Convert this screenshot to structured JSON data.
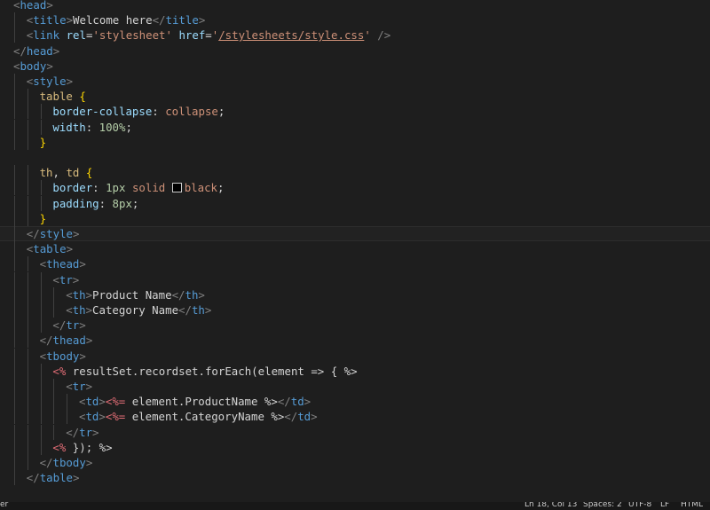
{
  "editor": {
    "lines": [
      {
        "indent": 0,
        "tokens": [
          [
            "tg",
            "<"
          ],
          [
            "tn",
            "head"
          ],
          [
            "tg",
            ">"
          ]
        ]
      },
      {
        "indent": 1,
        "tokens": [
          [
            "tg",
            "<"
          ],
          [
            "tn",
            "title"
          ],
          [
            "tg",
            ">"
          ],
          [
            "tx",
            "Welcome here"
          ],
          [
            "tg",
            "</"
          ],
          [
            "tn",
            "title"
          ],
          [
            "tg",
            ">"
          ]
        ]
      },
      {
        "indent": 1,
        "tokens": [
          [
            "tg",
            "<"
          ],
          [
            "tn",
            "link"
          ],
          [
            "tx",
            " "
          ],
          [
            "at",
            "rel"
          ],
          [
            "tx",
            "="
          ],
          [
            "sv",
            "'stylesheet'"
          ],
          [
            "tx",
            " "
          ],
          [
            "at",
            "href"
          ],
          [
            "tx",
            "="
          ],
          [
            "sv",
            "'"
          ],
          [
            "sl",
            "/stylesheets/style.css"
          ],
          [
            "sv",
            "'"
          ],
          [
            "tx",
            " "
          ],
          [
            "tg",
            "/>"
          ]
        ]
      },
      {
        "indent": 0,
        "tokens": [
          [
            "tg",
            "</"
          ],
          [
            "tn",
            "head"
          ],
          [
            "tg",
            ">"
          ]
        ]
      },
      {
        "indent": 0,
        "tokens": [
          [
            "tg",
            "<"
          ],
          [
            "tn",
            "body"
          ],
          [
            "tg",
            ">"
          ]
        ]
      },
      {
        "indent": 1,
        "tokens": [
          [
            "tg",
            "<"
          ],
          [
            "tn",
            "style"
          ],
          [
            "tg",
            ">"
          ]
        ]
      },
      {
        "indent": 2,
        "tokens": [
          [
            "sel",
            "table"
          ],
          [
            "tx",
            " "
          ],
          [
            "br",
            "{"
          ]
        ]
      },
      {
        "indent": 3,
        "tokens": [
          [
            "pr",
            "border-collapse"
          ],
          [
            "tx",
            ": "
          ],
          [
            "vl",
            "collapse"
          ],
          [
            "tx",
            ";"
          ]
        ]
      },
      {
        "indent": 3,
        "tokens": [
          [
            "pr",
            "width"
          ],
          [
            "tx",
            ": "
          ],
          [
            "num",
            "100%"
          ],
          [
            "tx",
            ";"
          ]
        ]
      },
      {
        "indent": 2,
        "tokens": [
          [
            "br",
            "}"
          ]
        ]
      },
      {
        "indent": 0,
        "tokens": []
      },
      {
        "indent": 2,
        "tokens": [
          [
            "sel",
            "th"
          ],
          [
            "tx",
            ", "
          ],
          [
            "sel",
            "td"
          ],
          [
            "tx",
            " "
          ],
          [
            "br",
            "{"
          ]
        ]
      },
      {
        "indent": 3,
        "tokens": [
          [
            "pr",
            "border"
          ],
          [
            "tx",
            ": "
          ],
          [
            "num",
            "1px"
          ],
          [
            "tx",
            " "
          ],
          [
            "vl",
            "solid"
          ],
          [
            "tx",
            " "
          ],
          [
            "swatch",
            ""
          ],
          [
            "vl",
            "black"
          ],
          [
            "tx",
            ";"
          ]
        ]
      },
      {
        "indent": 3,
        "tokens": [
          [
            "pr",
            "padding"
          ],
          [
            "tx",
            ": "
          ],
          [
            "num",
            "8px"
          ],
          [
            "tx",
            ";"
          ]
        ]
      },
      {
        "indent": 2,
        "tokens": [
          [
            "br",
            "}"
          ]
        ]
      },
      {
        "indent": 1,
        "active": true,
        "tokens": [
          [
            "tg",
            "</"
          ],
          [
            "tn",
            "style"
          ],
          [
            "tg",
            ">"
          ]
        ]
      },
      {
        "indent": 1,
        "tokens": [
          [
            "tg",
            "<"
          ],
          [
            "tn",
            "table"
          ],
          [
            "tg",
            ">"
          ]
        ]
      },
      {
        "indent": 2,
        "tokens": [
          [
            "tg",
            "<"
          ],
          [
            "tn",
            "thead"
          ],
          [
            "tg",
            ">"
          ]
        ]
      },
      {
        "indent": 3,
        "tokens": [
          [
            "tg",
            "<"
          ],
          [
            "tn",
            "tr"
          ],
          [
            "tg",
            ">"
          ]
        ]
      },
      {
        "indent": 4,
        "tokens": [
          [
            "tg",
            "<"
          ],
          [
            "tn",
            "th"
          ],
          [
            "tg",
            ">"
          ],
          [
            "tx",
            "Product Name"
          ],
          [
            "tg",
            "</"
          ],
          [
            "tn",
            "th"
          ],
          [
            "tg",
            ">"
          ]
        ]
      },
      {
        "indent": 4,
        "tokens": [
          [
            "tg",
            "<"
          ],
          [
            "tn",
            "th"
          ],
          [
            "tg",
            ">"
          ],
          [
            "tx",
            "Category Name"
          ],
          [
            "tg",
            "</"
          ],
          [
            "tn",
            "th"
          ],
          [
            "tg",
            ">"
          ]
        ]
      },
      {
        "indent": 3,
        "tokens": [
          [
            "tg",
            "</"
          ],
          [
            "tn",
            "tr"
          ],
          [
            "tg",
            ">"
          ]
        ]
      },
      {
        "indent": 2,
        "tokens": [
          [
            "tg",
            "</"
          ],
          [
            "tn",
            "thead"
          ],
          [
            "tg",
            ">"
          ]
        ]
      },
      {
        "indent": 2,
        "tokens": [
          [
            "tg",
            "<"
          ],
          [
            "tn",
            "tbody"
          ],
          [
            "tg",
            ">"
          ]
        ]
      },
      {
        "indent": 3,
        "tokens": [
          [
            "ejs",
            "<%"
          ],
          [
            "tx",
            " resultSet.recordset.forEach(element => { %>"
          ]
        ]
      },
      {
        "indent": 4,
        "tokens": [
          [
            "tg",
            "<"
          ],
          [
            "tn",
            "tr"
          ],
          [
            "tg",
            ">"
          ]
        ]
      },
      {
        "indent": 5,
        "tokens": [
          [
            "tg",
            "<"
          ],
          [
            "tn",
            "td"
          ],
          [
            "tg",
            ">"
          ],
          [
            "ejs",
            "<%="
          ],
          [
            "tx",
            " element.ProductName %>"
          ],
          [
            "tg",
            "</"
          ],
          [
            "tn",
            "td"
          ],
          [
            "tg",
            ">"
          ]
        ]
      },
      {
        "indent": 5,
        "tokens": [
          [
            "tg",
            "<"
          ],
          [
            "tn",
            "td"
          ],
          [
            "tg",
            ">"
          ],
          [
            "ejs",
            "<%="
          ],
          [
            "tx",
            " element.CategoryName %>"
          ],
          [
            "tg",
            "</"
          ],
          [
            "tn",
            "td"
          ],
          [
            "tg",
            ">"
          ]
        ]
      },
      {
        "indent": 4,
        "tokens": [
          [
            "tg",
            "</"
          ],
          [
            "tn",
            "tr"
          ],
          [
            "tg",
            ">"
          ]
        ]
      },
      {
        "indent": 3,
        "tokens": [
          [
            "ejs",
            "<%"
          ],
          [
            "tx",
            " }); %>"
          ]
        ]
      },
      {
        "indent": 2,
        "tokens": [
          [
            "tg",
            "</"
          ],
          [
            "tn",
            "tbody"
          ],
          [
            "tg",
            ">"
          ]
        ]
      },
      {
        "indent": 1,
        "tokens": [
          [
            "tg",
            "</"
          ],
          [
            "tn",
            "table"
          ],
          [
            "tg",
            ">"
          ]
        ]
      },
      {
        "indent": 0,
        "tokens": []
      }
    ]
  },
  "statusbar": {
    "left": "er",
    "cursor": "Ln 18, Col 13",
    "spaces": "Spaces: 2",
    "encoding": "UTF-8",
    "eol": "LF",
    "language": "HTML"
  }
}
